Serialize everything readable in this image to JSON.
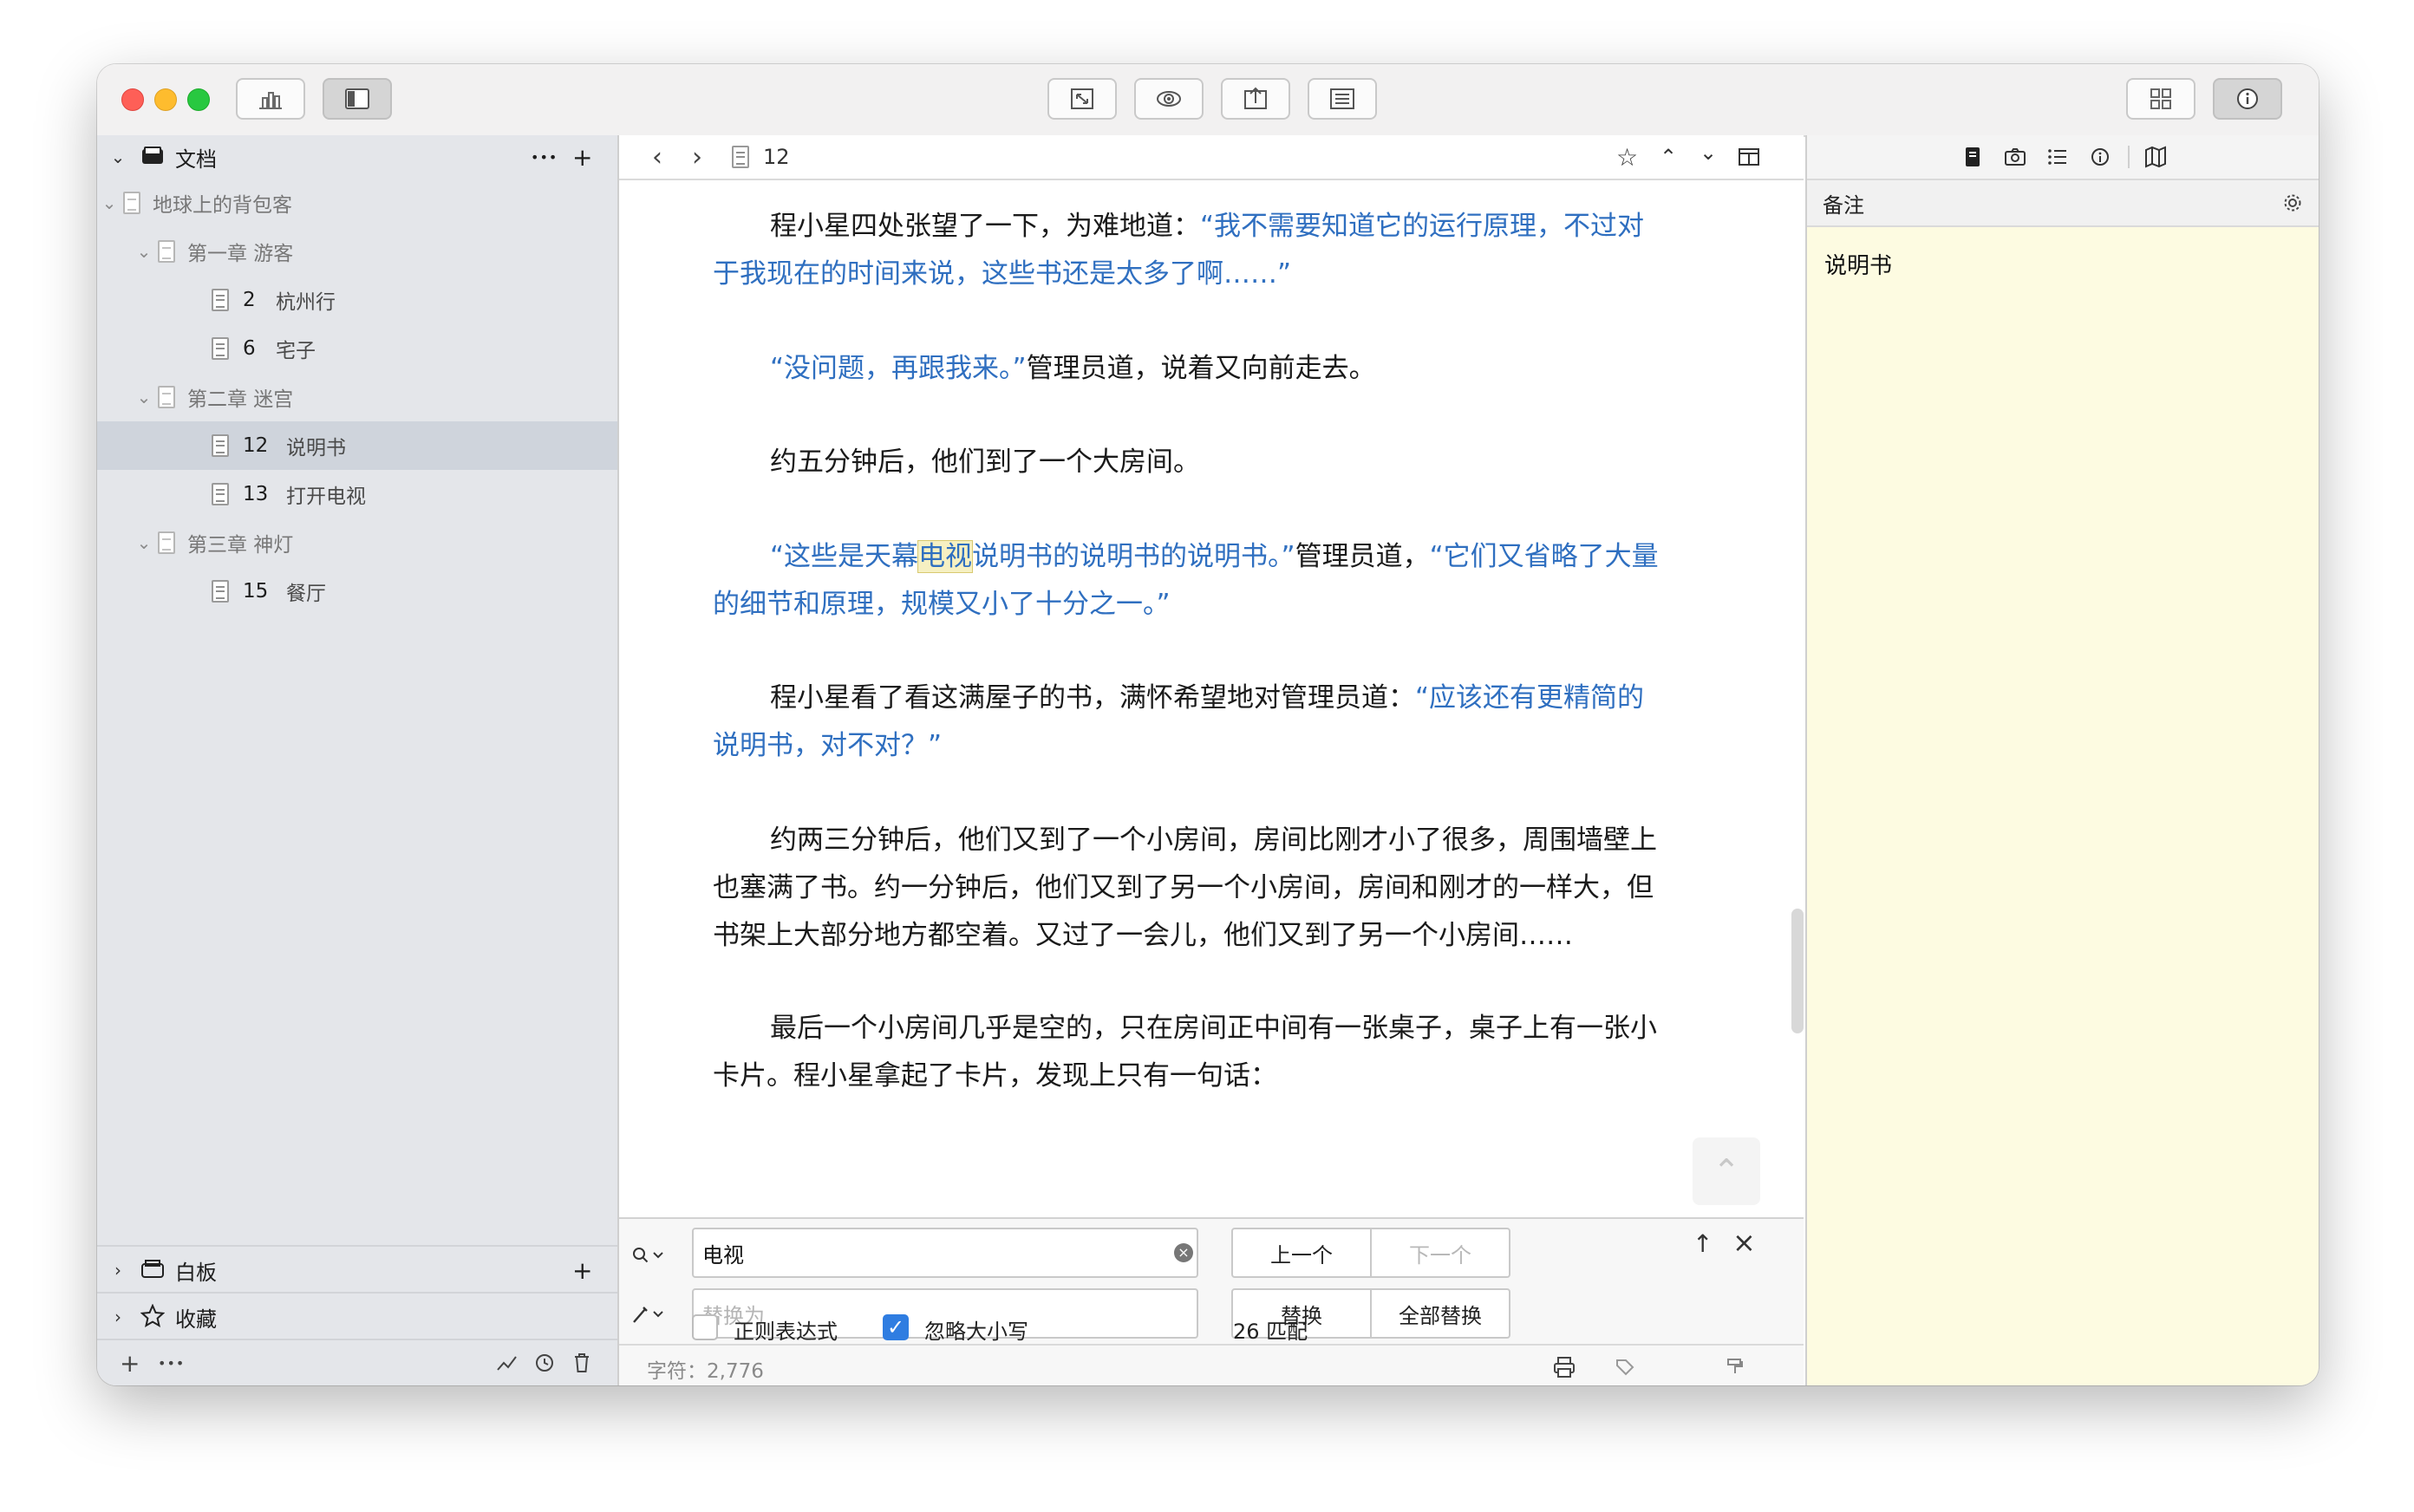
{
  "binder": {
    "header": "文档",
    "rows": [
      {
        "label": "地球上的背包客"
      },
      {
        "label": "第一章 游客"
      },
      {
        "num": "2",
        "label": "杭州行"
      },
      {
        "num": "6",
        "label": "宅子"
      },
      {
        "label": "第二章 迷宫"
      },
      {
        "num": "12",
        "label": "说明书"
      },
      {
        "num": "13",
        "label": "打开电视"
      },
      {
        "label": "第三章 神灯"
      },
      {
        "num": "15",
        "label": "餐厅"
      }
    ],
    "whiteboard": "白板",
    "favorites": "收藏"
  },
  "editor": {
    "doc_number": "12",
    "paragraphs": [
      {
        "plain": "程小星四处张望了一下，为难地道：",
        "quote": "“我不需要知道它的运行原理，不过对于我现在的时间来说，这些书还是太多了啊……”"
      },
      {
        "quote": "“没问题，再跟我来。”",
        "plain": "管理员道，说着又向前走去。"
      },
      {
        "plain": "约五分钟后，他们到了一个大房间。"
      },
      {
        "quote_a": "“这些是天幕",
        "highlight": "电视",
        "quote_b": "说明书的说明书的说明书。”",
        "plain": "管理员道，",
        "quote_c": "“它们又省略了大量的细节和原理，规模又小了十分之一。”"
      },
      {
        "plain": "程小星看了看这满屋子的书，满怀希望地对管理员道：",
        "quote": "“应该还有更精简的说明书，对不对？”"
      },
      {
        "plain": "约两三分钟后，他们又到了一个小房间，房间比刚才小了很多，周围墙壁上也塞满了书。约一分钟后，他们又到了另一个小房间，房间和刚才的一样大，但书架上大部分地方都空着。又过了一会儿，他们又到了另一个小房间……"
      },
      {
        "plain": "最后一个小房间几乎是空的，只在房间正中间有一张桌子，桌子上有一张小卡片。程小星拿起了卡片，发现上只有一句话："
      }
    ]
  },
  "find": {
    "search_value": "电视",
    "replace_placeholder": "替换为",
    "prev_label": "上一个",
    "next_label": "下一个",
    "replace_label": "替换",
    "replace_all_label": "全部替换",
    "regex_label": "正则表达式",
    "ignore_case_label": "忽略大小写",
    "match_count": "26 匹配"
  },
  "footer": {
    "char_count": "字符：2,776"
  },
  "inspector": {
    "section": "备注",
    "notes_text": "说明书"
  },
  "colors": {
    "accent": "#2f7de1",
    "dialogue": "#2f6fc0",
    "notes_bg": "#fdfbe1",
    "sidebar_bg": "#e4e6ea",
    "selected_row": "#cfd4dc"
  },
  "icons": {
    "checkmark": "✓",
    "plus": "+",
    "more": "•••"
  }
}
